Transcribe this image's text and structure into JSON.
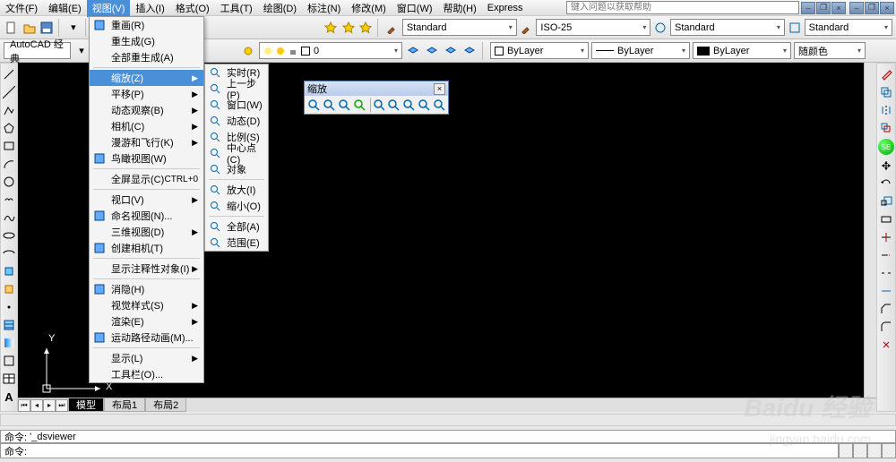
{
  "menubar": {
    "items": [
      "文件(F)",
      "编辑(E)",
      "视图(V)",
      "插入(I)",
      "格式(O)",
      "工具(T)",
      "绘图(D)",
      "标注(N)",
      "修改(M)",
      "窗口(W)",
      "帮助(H)",
      "Express"
    ],
    "active_index": 2,
    "search_placeholder": "键入问题以获取帮助"
  },
  "toolbar1": {
    "std1": "Standard",
    "std2": "ISO-25",
    "std3": "Standard",
    "std4": "Standard"
  },
  "toolbar2": {
    "workspace": "AutoCAD 经典",
    "layer0": "0",
    "bylayer1": "ByLayer",
    "bylayer2": "ByLayer",
    "bylayer3": "ByLayer",
    "color_mode": "随颜色"
  },
  "view_menu": {
    "items": [
      {
        "label": "重画(R)",
        "icon": "pencil"
      },
      {
        "label": "重生成(G)"
      },
      {
        "label": "全部重生成(A)"
      },
      {
        "sep": true
      },
      {
        "label": "缩放(Z)",
        "sub": true,
        "hover": true
      },
      {
        "label": "平移(P)",
        "sub": true
      },
      {
        "label": "动态观察(B)",
        "sub": true
      },
      {
        "label": "相机(C)",
        "sub": true
      },
      {
        "label": "漫游和飞行(K)",
        "sub": true
      },
      {
        "label": "鸟瞰视图(W)",
        "icon": "bird"
      },
      {
        "sep": true
      },
      {
        "label": "全屏显示(C)",
        "shortcut": "CTRL+0"
      },
      {
        "sep": true
      },
      {
        "label": "视口(V)",
        "sub": true
      },
      {
        "label": "命名视图(N)...",
        "icon": "named"
      },
      {
        "label": "三维视图(D)",
        "sub": true
      },
      {
        "label": "创建相机(T)",
        "icon": "camera"
      },
      {
        "sep": true
      },
      {
        "label": "显示注释性对象(I)",
        "sub": true
      },
      {
        "sep": true
      },
      {
        "label": "消隐(H)",
        "icon": "hide"
      },
      {
        "label": "视觉样式(S)",
        "sub": true
      },
      {
        "label": "渲染(E)",
        "sub": true
      },
      {
        "label": "运动路径动画(M)...",
        "icon": "anim"
      },
      {
        "sep": true
      },
      {
        "label": "显示(L)",
        "sub": true
      },
      {
        "label": "工具栏(O)..."
      }
    ]
  },
  "zoom_submenu": {
    "items": [
      {
        "label": "实时(R)",
        "icon": "z"
      },
      {
        "label": "上一步(P)",
        "icon": "z"
      },
      {
        "label": "窗口(W)",
        "icon": "z"
      },
      {
        "label": "动态(D)",
        "icon": "z"
      },
      {
        "label": "比例(S)",
        "icon": "z"
      },
      {
        "label": "中心点(C)",
        "icon": "z"
      },
      {
        "label": "对象",
        "icon": "z"
      },
      {
        "sep": true
      },
      {
        "label": "放大(I)",
        "icon": "z"
      },
      {
        "label": "缩小(O)",
        "icon": "z"
      },
      {
        "sep": true
      },
      {
        "label": "全部(A)",
        "icon": "z"
      },
      {
        "label": "范围(E)",
        "icon": "z"
      }
    ]
  },
  "float_window": {
    "title": "缩放",
    "icon_count": 9
  },
  "ucs": {
    "y": "Y",
    "x": "X"
  },
  "tabs": {
    "items": [
      "模型",
      "布局1",
      "布局2"
    ],
    "active_index": 0
  },
  "command": {
    "line1_label": "命令:",
    "line1_text": "'_dsviewer",
    "line2_label": "命令:"
  },
  "watermark": {
    "big": "Baidu 经验",
    "small": "jingyan.baidu.com"
  },
  "right_panel": {
    "se_label": "SE"
  }
}
